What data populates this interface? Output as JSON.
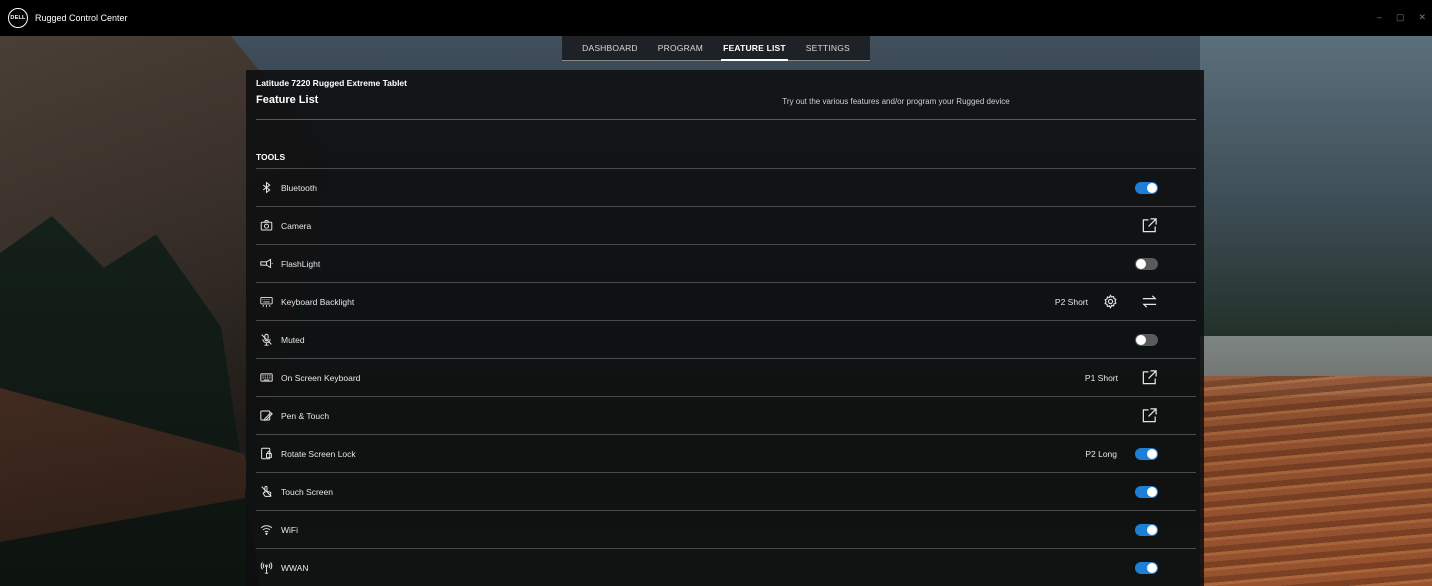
{
  "window": {
    "title": "Rugged Control Center",
    "logo_text": "DELL",
    "controls": [
      "–",
      "▢",
      "✕"
    ]
  },
  "tabs": [
    {
      "label": "DASHBOARD",
      "active": false
    },
    {
      "label": "PROGRAM",
      "active": false
    },
    {
      "label": "FEATURE LIST",
      "active": true
    },
    {
      "label": "SETTINGS",
      "active": false
    }
  ],
  "header": {
    "device": "Latitude 7220 Rugged Extreme Tablet",
    "title": "Feature List",
    "subtitle": "Try out the various features and/or program your Rugged device"
  },
  "section": {
    "label": "TOOLS"
  },
  "features": [
    {
      "label": "Bluetooth",
      "icon": "bluetooth-icon",
      "shortcut": "",
      "control": "toggle",
      "state": "on"
    },
    {
      "label": "Camera",
      "icon": "camera-icon",
      "shortcut": "",
      "control": "external",
      "state": ""
    },
    {
      "label": "FlashLight",
      "icon": "flashlight-icon",
      "shortcut": "",
      "control": "toggle",
      "state": "off"
    },
    {
      "label": "Keyboard Backlight",
      "icon": "keyboard-backlight-icon",
      "shortcut": "P2 Short",
      "control": "settings-swap",
      "state": ""
    },
    {
      "label": "Muted",
      "icon": "mic-off-icon",
      "shortcut": "",
      "control": "toggle",
      "state": "off"
    },
    {
      "label": "On Screen Keyboard",
      "icon": "keyboard-icon",
      "shortcut": "P1 Short",
      "control": "external",
      "state": ""
    },
    {
      "label": "Pen & Touch",
      "icon": "pen-touch-icon",
      "shortcut": "",
      "control": "external",
      "state": ""
    },
    {
      "label": "Rotate Screen Lock",
      "icon": "rotate-lock-icon",
      "shortcut": "P2 Long",
      "control": "toggle",
      "state": "on"
    },
    {
      "label": "Touch Screen",
      "icon": "touch-icon",
      "shortcut": "",
      "control": "toggle",
      "state": "on"
    },
    {
      "label": "WiFi",
      "icon": "wifi-icon",
      "shortcut": "",
      "control": "toggle",
      "state": "on"
    },
    {
      "label": "WWAN",
      "icon": "antenna-icon",
      "shortcut": "",
      "control": "toggle",
      "state": "on"
    }
  ],
  "colors": {
    "toggle_on": "#1e7fd6",
    "toggle_off": "#5a5a5a"
  }
}
